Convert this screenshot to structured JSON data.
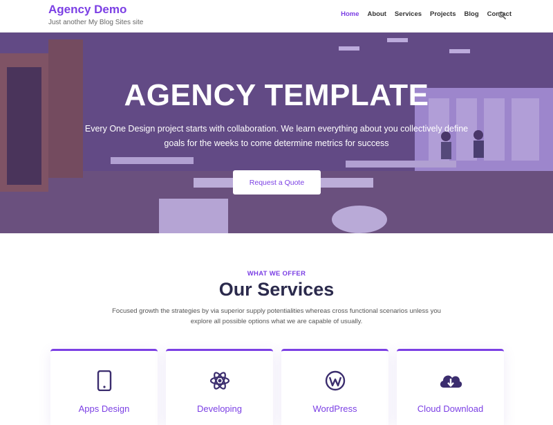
{
  "brand": {
    "title": "Agency Demo",
    "tagline": "Just another My Blog Sites site"
  },
  "nav": {
    "items": [
      {
        "label": "Home",
        "active": true
      },
      {
        "label": "About",
        "active": false
      },
      {
        "label": "Services",
        "active": false
      },
      {
        "label": "Projects",
        "active": false
      },
      {
        "label": "Blog",
        "active": false
      },
      {
        "label": "Contact",
        "active": false
      }
    ],
    "search_icon": "search-icon"
  },
  "hero": {
    "title": "AGENCY TEMPLATE",
    "text": "Every One Design project starts with collaboration. We learn everything about you collectively define goals for the weeks to come determine metrics for success",
    "button_label": "Request a Quote"
  },
  "services": {
    "eyebrow": "WHAT WE OFFER",
    "title": "Our Services",
    "description": "Focused growth the strategies by via superior supply potentialities whereas cross functional scenarios unless you explore all possible options what we are capable of usually.",
    "cards": [
      {
        "title": "Apps Design",
        "icon": "mobile-phone-icon"
      },
      {
        "title": "Developing",
        "icon": "atom-icon"
      },
      {
        "title": "WordPress",
        "icon": "wordpress-icon"
      },
      {
        "title": "Cloud Download",
        "icon": "cloud-download-icon"
      }
    ]
  },
  "colors": {
    "accent": "#7b3fe4",
    "heading": "#2b2a4c",
    "icon": "#3b2d6e"
  }
}
